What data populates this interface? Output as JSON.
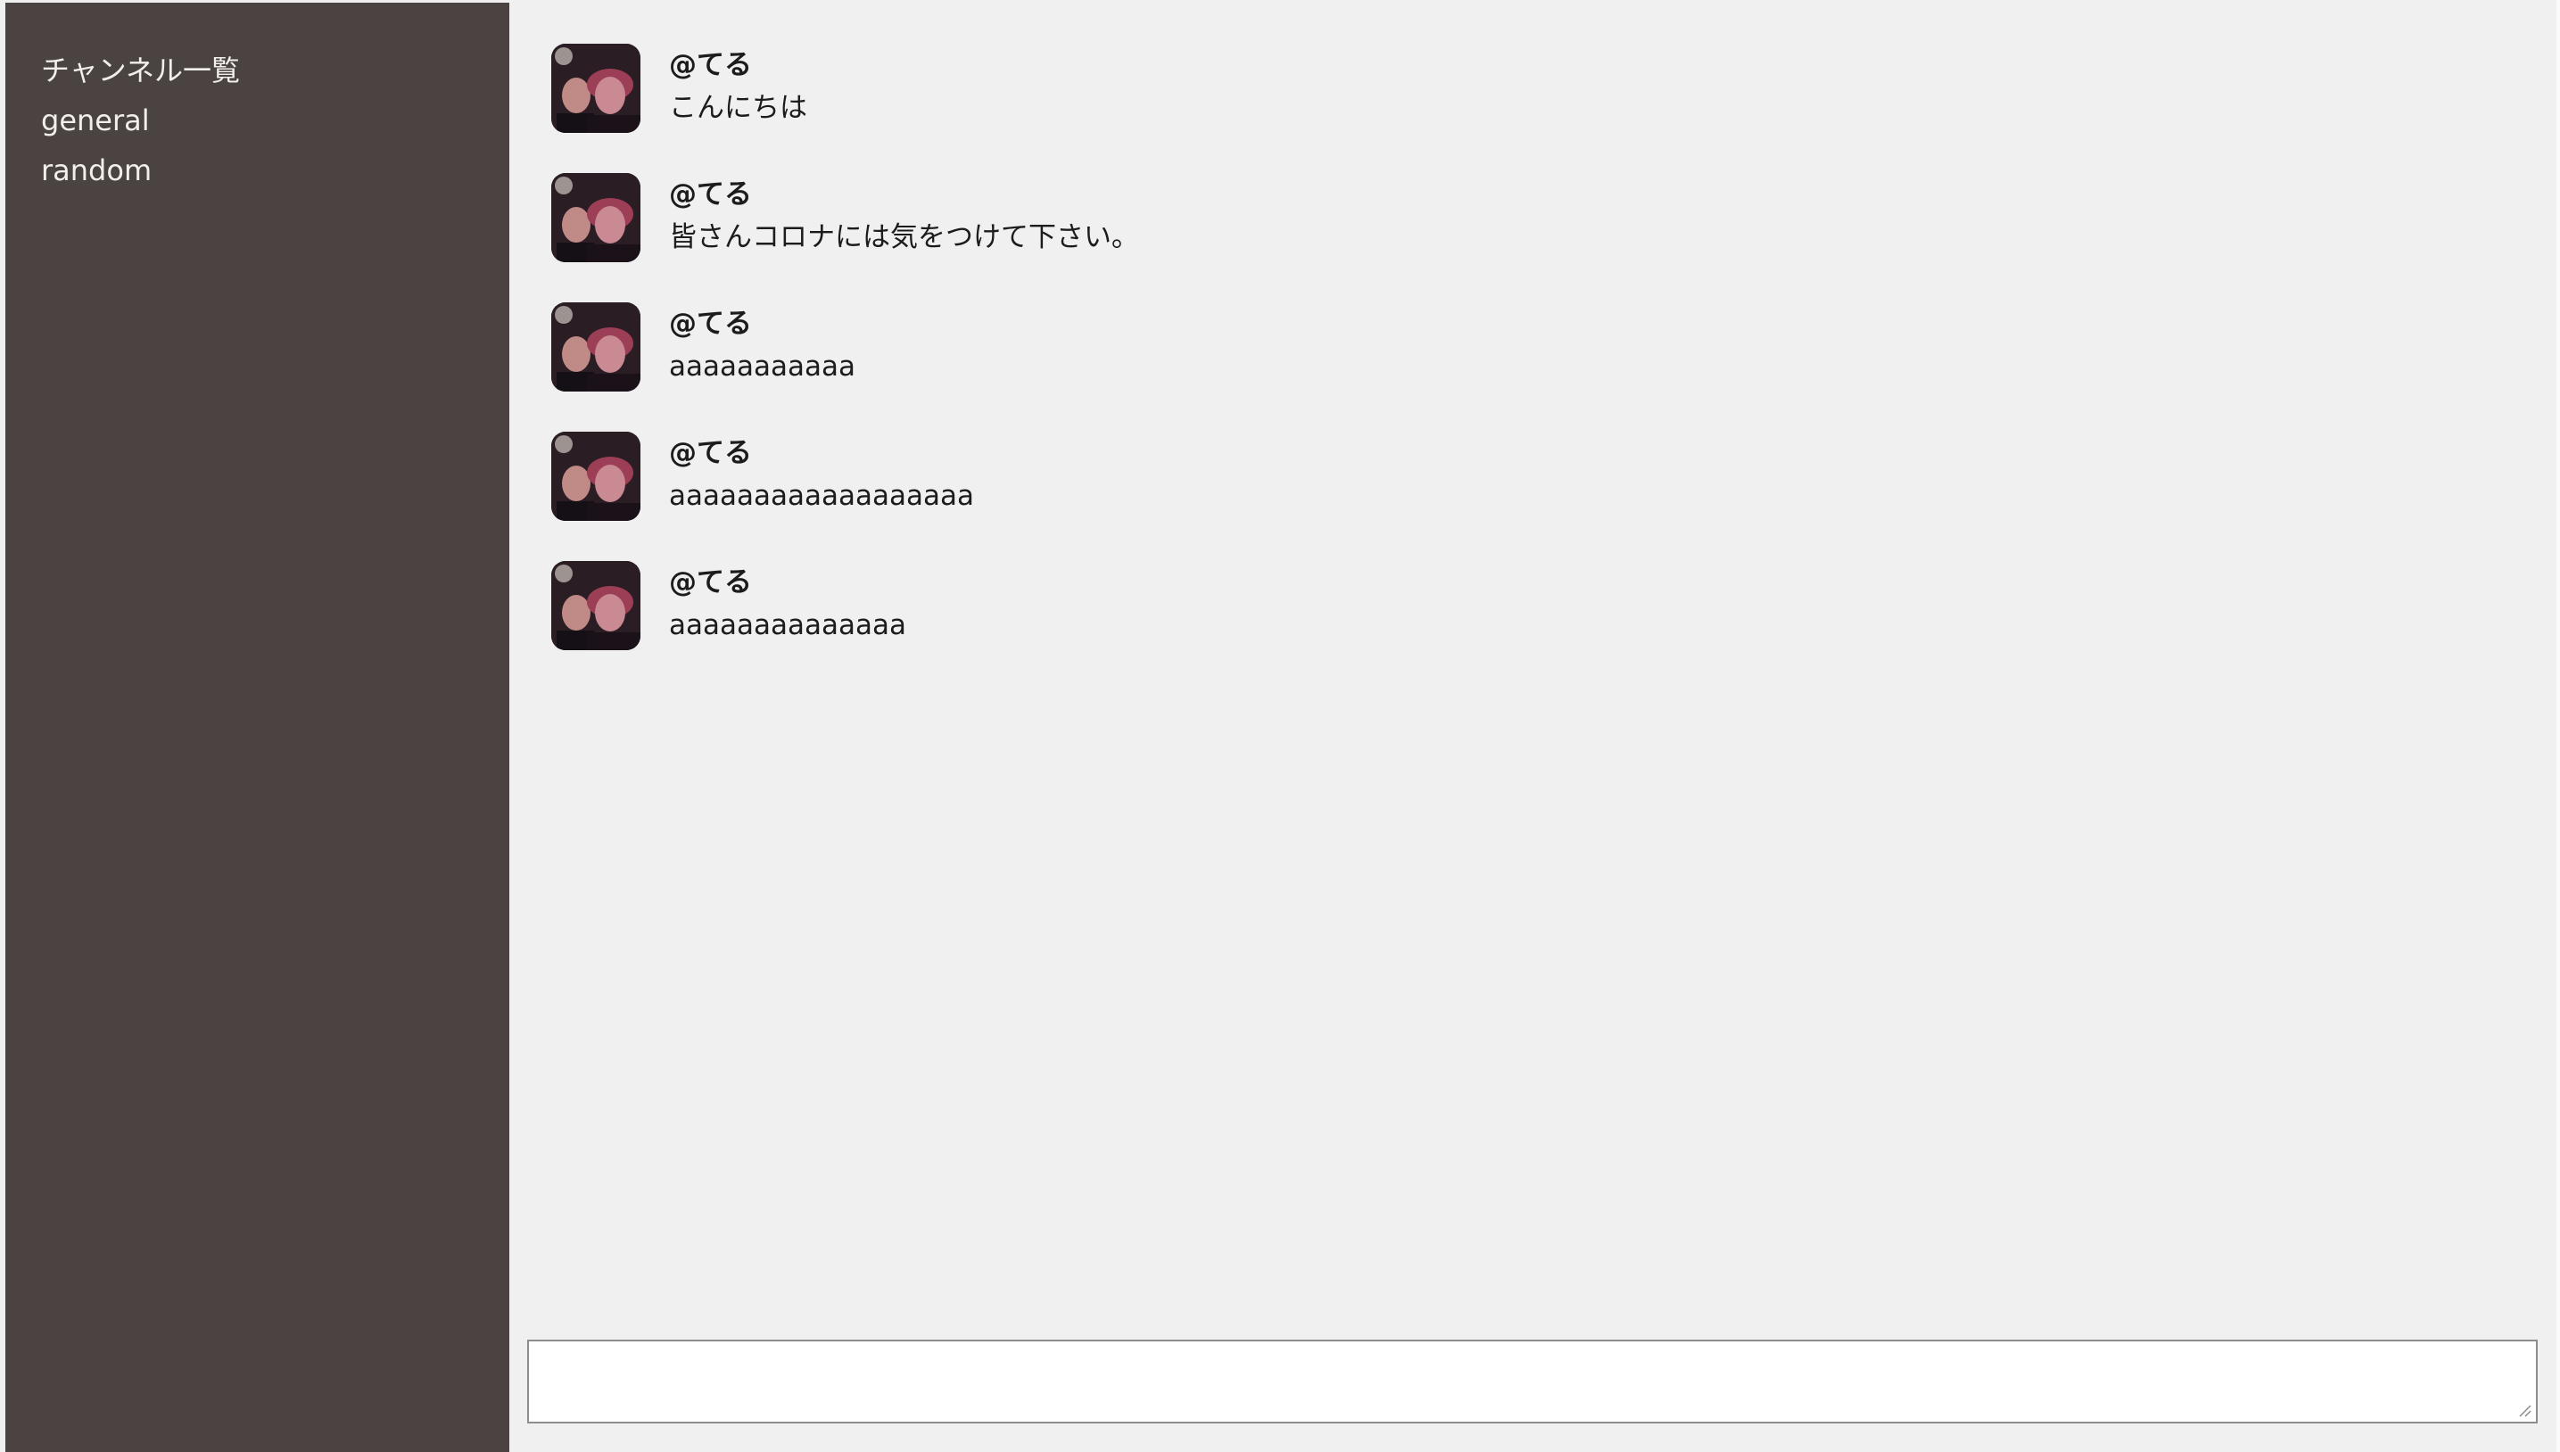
{
  "sidebar": {
    "title": "チャンネル一覧",
    "channels": [
      {
        "label": "general"
      },
      {
        "label": "random"
      }
    ]
  },
  "messages": [
    {
      "user": "@てる",
      "text": "こんにちは",
      "avatar": "user-avatar-photo"
    },
    {
      "user": "@てる",
      "text": "皆さんコロナには気をつけて下さい。",
      "avatar": "user-avatar-photo"
    },
    {
      "user": "@てる",
      "text": "aaaaaaaaaaa",
      "avatar": "user-avatar-photo"
    },
    {
      "user": "@てる",
      "text": "aaaaaaaaaaaaaaaaaa",
      "avatar": "user-avatar-photo"
    },
    {
      "user": "@てる",
      "text": "aaaaaaaaaaaaaa",
      "avatar": "user-avatar-photo"
    }
  ],
  "composer": {
    "value": "",
    "placeholder": ""
  },
  "colors": {
    "sidebar_bg": "#4a4341",
    "sidebar_text": "#f1eeec",
    "main_bg": "#f0f0f0",
    "message_text": "#1c1c1c"
  }
}
